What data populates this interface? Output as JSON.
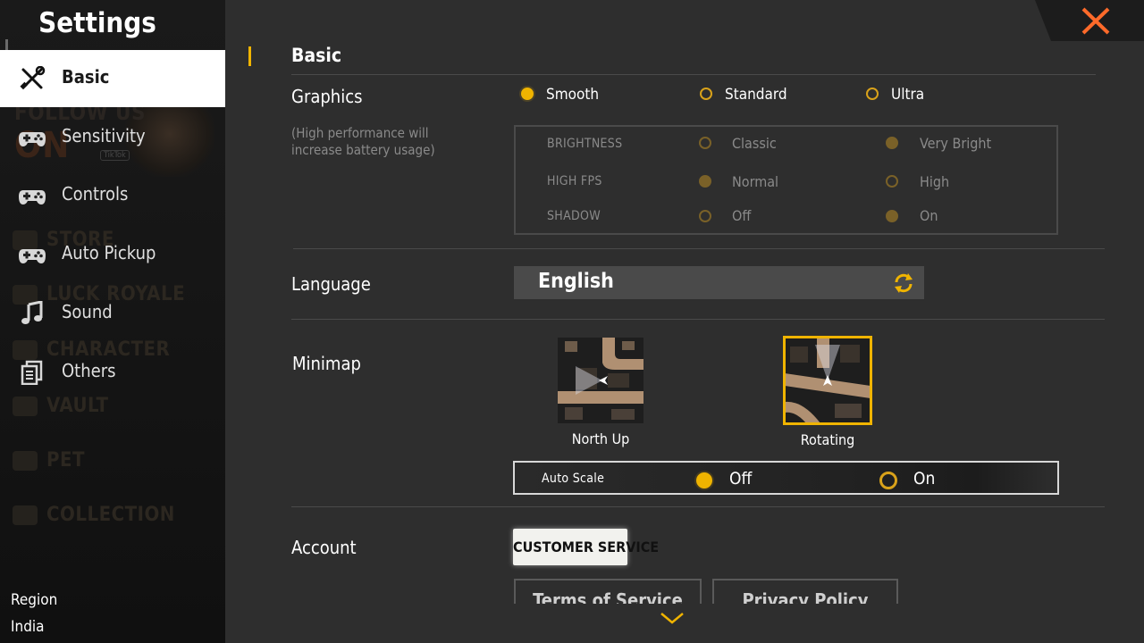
{
  "sidebar": {
    "title": "Settings",
    "items": [
      {
        "label": "Basic",
        "icon": "tools-icon",
        "active": true
      },
      {
        "label": "Sensitivity",
        "icon": "gamepad-icon"
      },
      {
        "label": "Controls",
        "icon": "gamepad-icon"
      },
      {
        "label": "Auto Pickup",
        "icon": "gamepad-icon"
      },
      {
        "label": "Sound",
        "icon": "music-note-icon"
      },
      {
        "label": "Others",
        "icon": "document-icon"
      }
    ],
    "background_words": [
      "FOLLOW US",
      "ON",
      "STORE",
      "LUCK ROYALE",
      "CHARACTER",
      "VAULT",
      "PET",
      "COLLECTION"
    ],
    "background_badge": "TikTok",
    "region_label": "Region",
    "region_value": "India"
  },
  "main": {
    "section_title": "Basic",
    "graphics": {
      "label": "Graphics",
      "hint": "(High performance will increase battery usage)",
      "options": [
        {
          "label": "Smooth",
          "selected": true
        },
        {
          "label": "Standard",
          "selected": false
        },
        {
          "label": "Ultra",
          "selected": false
        }
      ],
      "advanced": [
        {
          "label": "BRIGHTNESS",
          "options": [
            {
              "label": "Classic",
              "selected": false
            },
            {
              "label": "Very Bright",
              "selected": true
            }
          ]
        },
        {
          "label": "HIGH FPS",
          "options": [
            {
              "label": "Normal",
              "selected": true
            },
            {
              "label": "High",
              "selected": false
            }
          ]
        },
        {
          "label": "SHADOW",
          "options": [
            {
              "label": "Off",
              "selected": false
            },
            {
              "label": "On",
              "selected": true
            }
          ]
        }
      ]
    },
    "language": {
      "label": "Language",
      "value": "English"
    },
    "minimap": {
      "label": "Minimap",
      "options": [
        {
          "label": "North Up",
          "selected": false
        },
        {
          "label": "Rotating",
          "selected": true
        }
      ],
      "auto_scale": {
        "label": "Auto Scale",
        "options": [
          {
            "label": "Off",
            "selected": true
          },
          {
            "label": "On",
            "selected": false
          }
        ]
      }
    },
    "account": {
      "label": "Account",
      "customer_service": "CUSTOMER SERVICE",
      "terms": "Terms of Service",
      "privacy": "Privacy Policy"
    }
  },
  "colors": {
    "accent": "#f0b400",
    "close": "#ff6a2a",
    "panel": "#2e2e2e",
    "sidebar": "#161616"
  }
}
